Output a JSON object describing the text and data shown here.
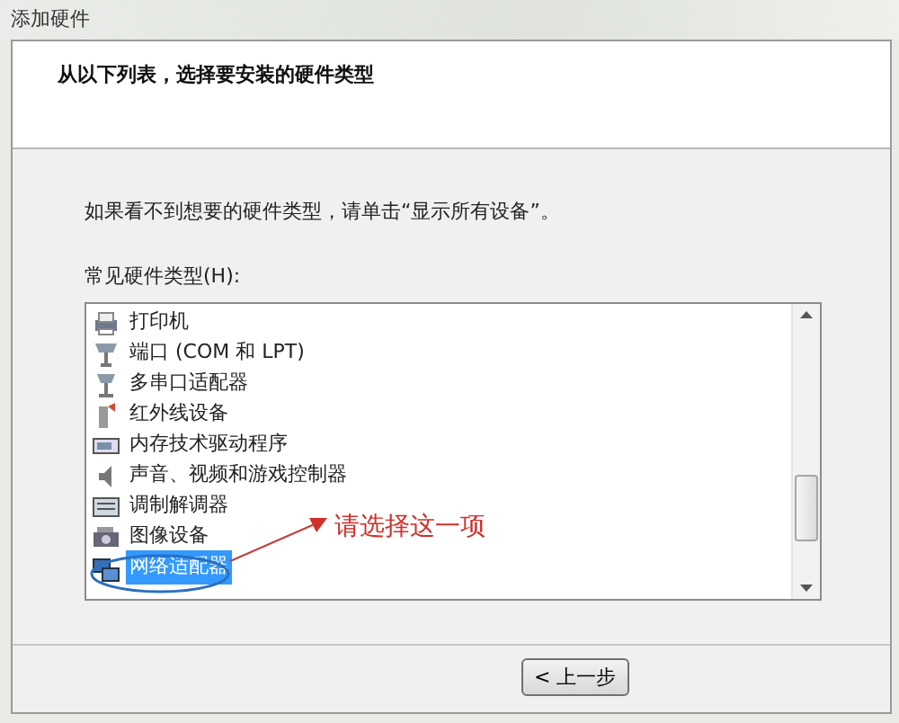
{
  "window": {
    "title": "添加硬件"
  },
  "header": {
    "heading": "从以下列表，选择要安装的硬件类型"
  },
  "instruction": "如果看不到想要的硬件类型，请单击“显示所有设备”。",
  "list_label": "常见硬件类型(H):",
  "items": [
    {
      "label": "打印机",
      "selected": false
    },
    {
      "label": "端口 (COM 和 LPT)",
      "selected": false
    },
    {
      "label": "多串口适配器",
      "selected": false
    },
    {
      "label": "红外线设备",
      "selected": false
    },
    {
      "label": "内存技术驱动程序",
      "selected": false
    },
    {
      "label": "声音、视频和游戏控制器",
      "selected": false
    },
    {
      "label": "调制解调器",
      "selected": false
    },
    {
      "label": "图像设备",
      "selected": false
    },
    {
      "label": "网络适配器",
      "selected": true
    }
  ],
  "annotation": {
    "text": "请选择这一项"
  },
  "buttons": [
    {
      "label": "< 上一步"
    }
  ]
}
